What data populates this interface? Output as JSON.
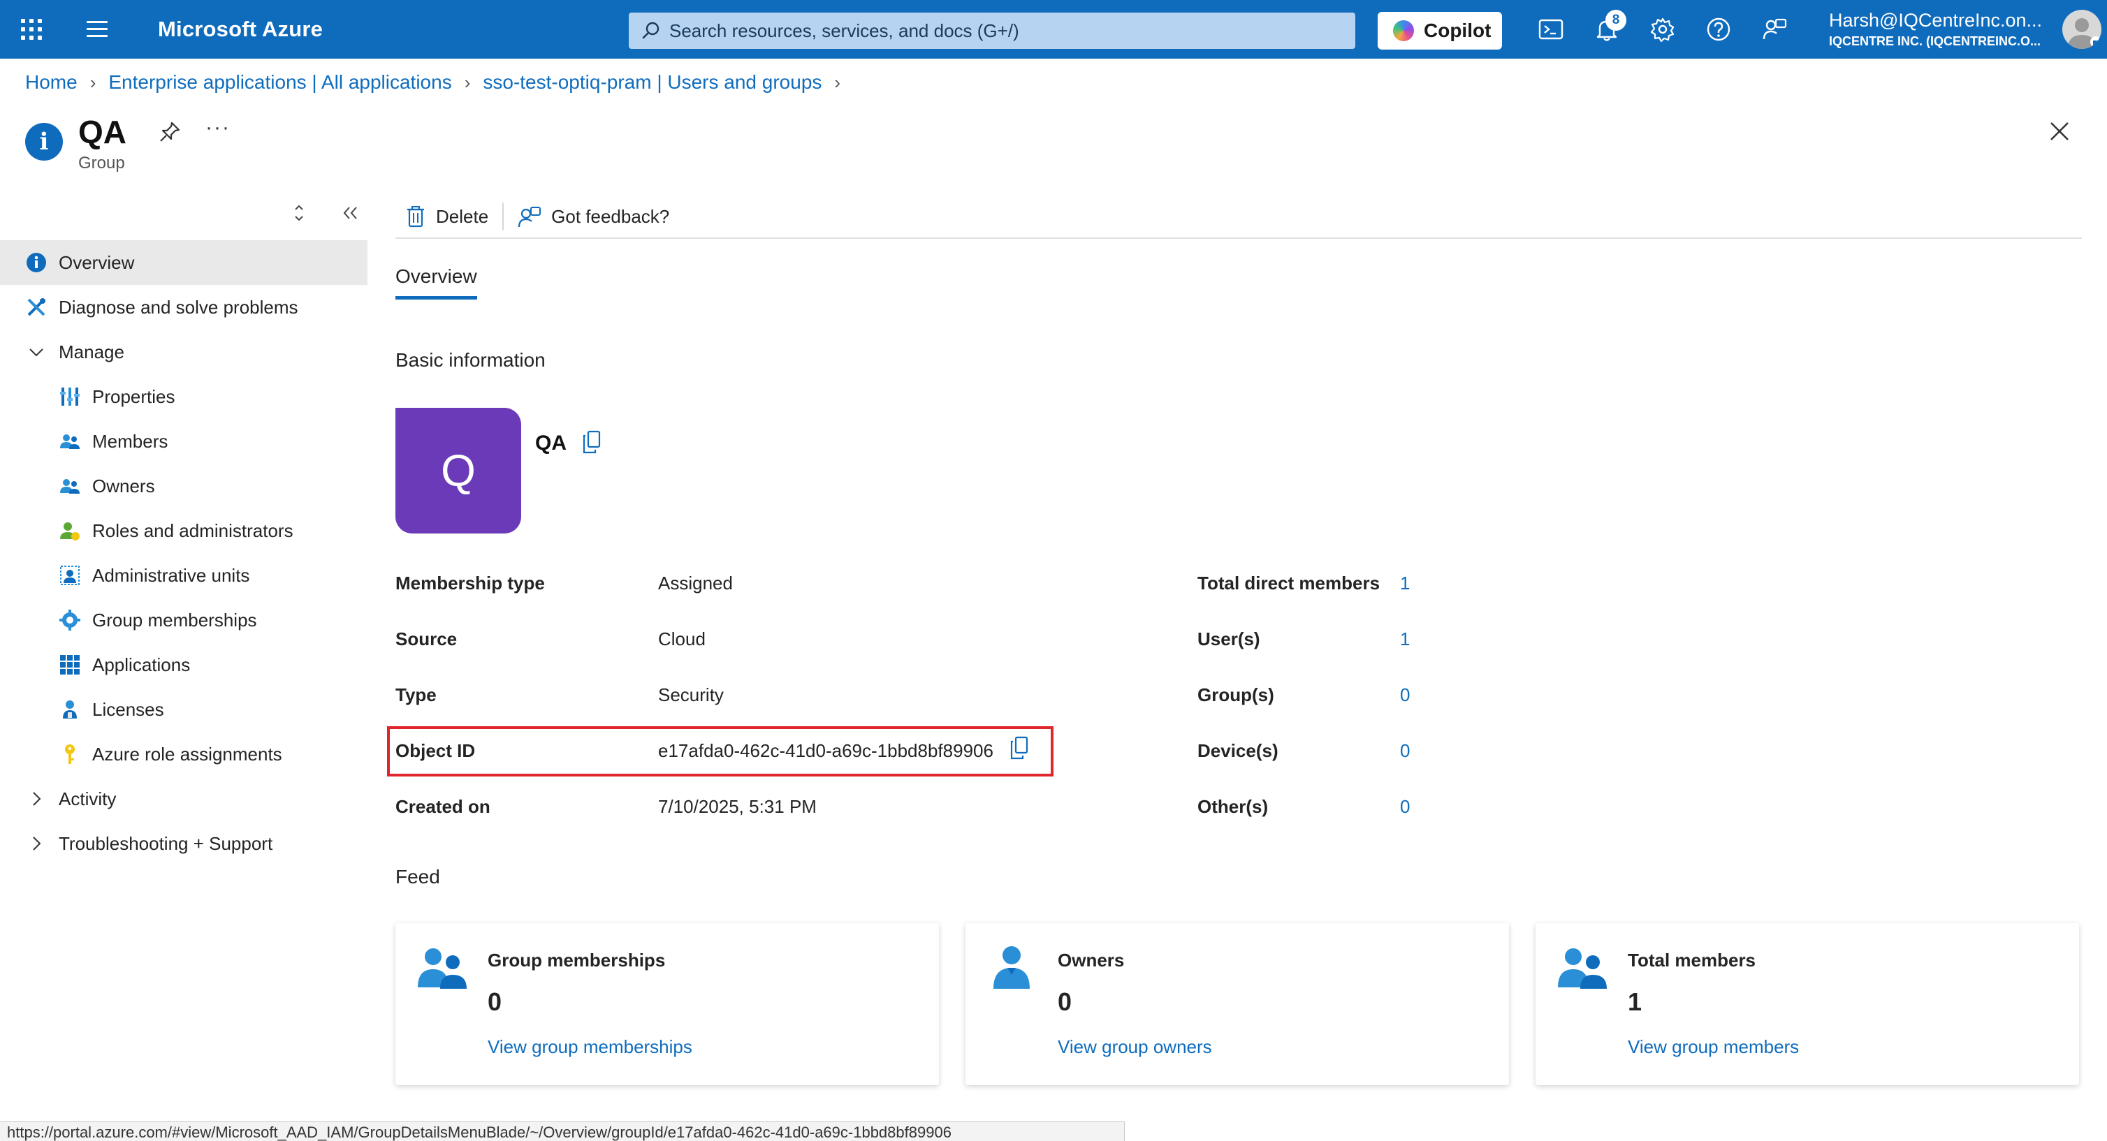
{
  "topbar": {
    "brand": "Microsoft Azure",
    "search_placeholder": "Search resources, services, and docs (G+/)",
    "copilot_label": "Copilot",
    "notification_count": "8",
    "account_email": "Harsh@IQCentreInc.on...",
    "account_tenant": "IQCENTRE INC. (IQCENTREINC.O..."
  },
  "breadcrumb": {
    "items": [
      "Home",
      "Enterprise applications | All applications",
      "sso-test-optiq-pram | Users and groups"
    ]
  },
  "page": {
    "title": "QA",
    "subtitle": "Group"
  },
  "nav": {
    "overview": "Overview",
    "diagnose": "Diagnose and solve problems",
    "manage": "Manage",
    "properties": "Properties",
    "members": "Members",
    "owners": "Owners",
    "roles": "Roles and administrators",
    "admin_units": "Administrative units",
    "group_memberships": "Group memberships",
    "applications": "Applications",
    "licenses": "Licenses",
    "azure_roles": "Azure role assignments",
    "activity": "Activity",
    "troubleshooting": "Troubleshooting + Support"
  },
  "commands": {
    "delete": "Delete",
    "feedback": "Got feedback?"
  },
  "tabs": {
    "overview": "Overview"
  },
  "basic_info": {
    "title": "Basic information",
    "tile_letter": "Q",
    "group_name": "QA",
    "properties": [
      {
        "label": "Membership type",
        "value": "Assigned"
      },
      {
        "label": "Source",
        "value": "Cloud"
      },
      {
        "label": "Type",
        "value": "Security"
      },
      {
        "label": "Object ID",
        "value": "e17afda0-462c-41d0-a69c-1bbd8bf89906"
      },
      {
        "label": "Created on",
        "value": "7/10/2025, 5:31 PM"
      }
    ],
    "stats": [
      {
        "label": "Total direct members",
        "value": "1"
      },
      {
        "label": "User(s)",
        "value": "1"
      },
      {
        "label": "Group(s)",
        "value": "0"
      },
      {
        "label": "Device(s)",
        "value": "0"
      },
      {
        "label": "Other(s)",
        "value": "0"
      }
    ]
  },
  "feed": {
    "title": "Feed",
    "cards": [
      {
        "title": "Group memberships",
        "value": "0",
        "link": "View group memberships"
      },
      {
        "title": "Owners",
        "value": "0",
        "link": "View group owners"
      },
      {
        "title": "Total members",
        "value": "1",
        "link": "View group members"
      }
    ]
  },
  "statusbar": {
    "url": "https://portal.azure.com/#view/Microsoft_AAD_IAM/GroupDetailsMenuBlade/~/Overview/groupId/e17afda0-462c-41d0-a69c-1bbd8bf89906"
  },
  "colors": {
    "accent": "#0f6cbd",
    "group_tile": "#6b3ab8",
    "highlight": "#e0262c"
  }
}
